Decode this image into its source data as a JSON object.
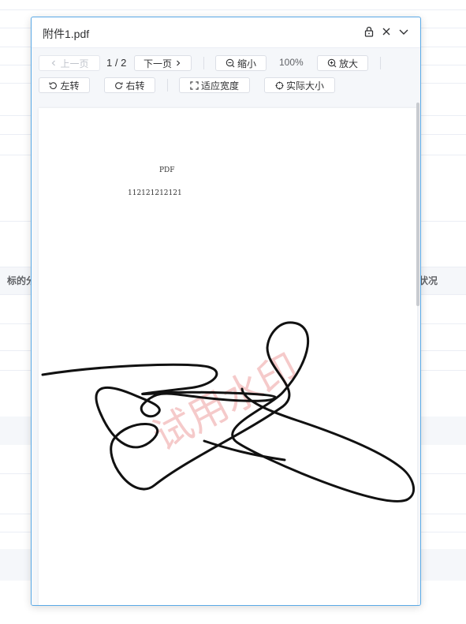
{
  "background": {
    "table_header_left": "标的分",
    "table_header_right": "状况"
  },
  "dialog": {
    "title": "附件1.pdf",
    "header_icons": [
      "lock-icon",
      "close-icon",
      "chevron-down-icon"
    ]
  },
  "toolbar": {
    "prev_label": "上一页",
    "page_indicator": "1 / 2",
    "next_label": "下一页",
    "zoom_out_label": "缩小",
    "zoom_level": "100%",
    "zoom_in_label": "放大",
    "rotate_left_label": "左转",
    "rotate_right_label": "右转",
    "fit_width_label": "适应宽度",
    "actual_size_label": "实际大小"
  },
  "document": {
    "line1": "PDF",
    "line2": "112121212121",
    "watermark": "试用水印"
  },
  "colors": {
    "dialog_border": "#5aa9e6",
    "toolbar_bg": "#f5f7fa",
    "watermark": "#f2b8b8"
  }
}
